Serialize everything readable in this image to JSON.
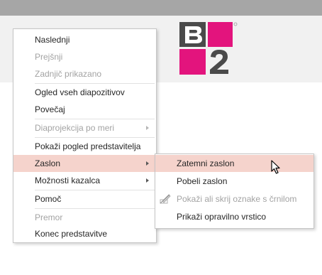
{
  "logo": {
    "text": "B2",
    "colors": {
      "dark": "#4a4a4a",
      "magenta": "#e3147d"
    }
  },
  "context_menu": {
    "items": [
      {
        "label": "Naslednji",
        "disabled": false
      },
      {
        "label": "Prejšnji",
        "disabled": true
      },
      {
        "label": "Zadnjič prikazano",
        "disabled": true
      },
      {
        "label": "Ogled vseh diapozitivov",
        "disabled": false
      },
      {
        "label": "Povečaj",
        "disabled": false
      },
      {
        "label": "Diaprojekcija po meri",
        "disabled": true,
        "submenu": true
      },
      {
        "label": "Pokaži pogled predstavitelja",
        "disabled": false
      },
      {
        "label": "Zaslon",
        "disabled": false,
        "submenu": true,
        "highlighted": true
      },
      {
        "label": "Možnosti kazalca",
        "disabled": false,
        "submenu": true
      },
      {
        "label": "Pomoč",
        "disabled": false
      },
      {
        "label": "Premor",
        "disabled": true
      },
      {
        "label": "Konec predstavitve",
        "disabled": false
      }
    ]
  },
  "submenu": {
    "items": [
      {
        "label": "Zatemni zaslon",
        "highlighted": true
      },
      {
        "label": "Pobeli zaslon"
      },
      {
        "label": "Pokaži ali skrij oznake s črnilom",
        "disabled": true,
        "icon": "ink-markup-icon"
      },
      {
        "label": "Prikaži opravilno vrstico"
      }
    ]
  },
  "colors": {
    "highlight": "#f5d3cc",
    "disabled_text": "#a3a3a3",
    "text": "#262626"
  }
}
